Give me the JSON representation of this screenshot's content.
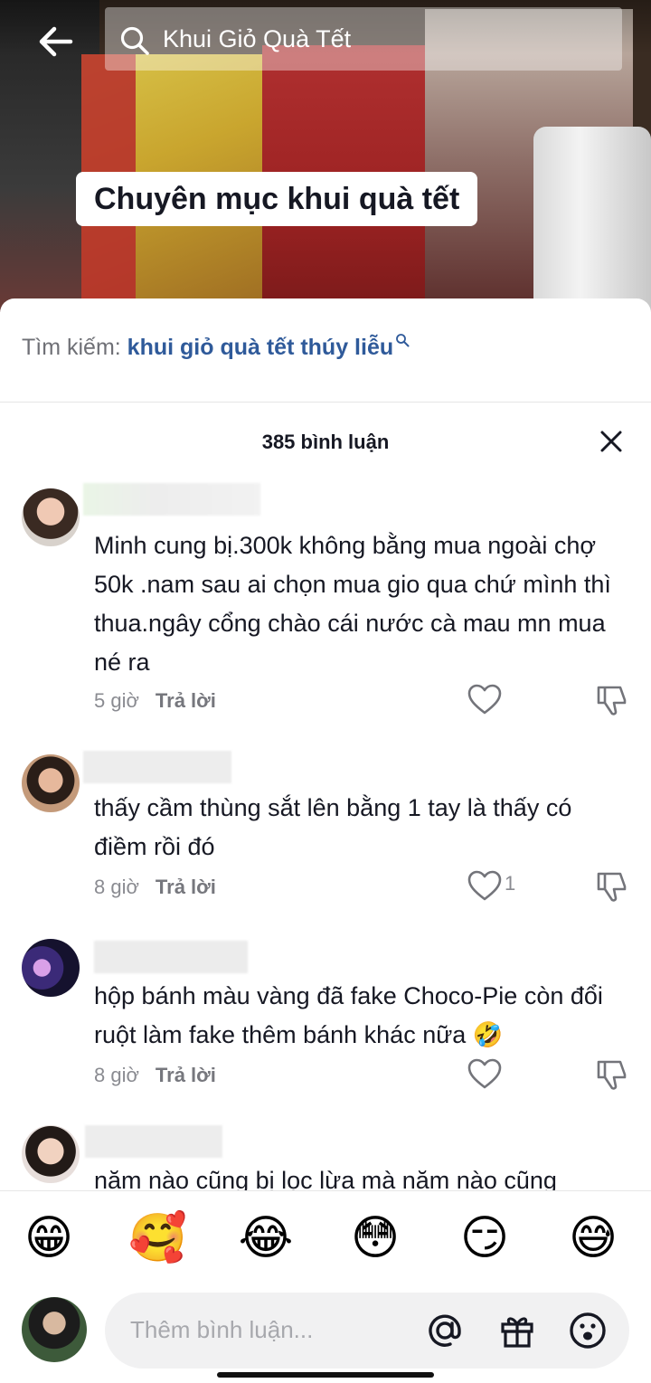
{
  "search": {
    "query": "Khui Giỏ Quà Tết"
  },
  "video": {
    "caption": "Chuyên mục khui quà tết"
  },
  "panel": {
    "suggest_label": "Tìm kiếm:",
    "suggest_term": "khui giỏ quà tết thúy liễu",
    "comment_count": "385 bình luận"
  },
  "comments": [
    {
      "text": "Minh cung bị.300k không bằng mua ngoài chợ 50k .nam sau ai chọn mua gio qua chứ mình thì thua.ngây cổng chào cái nước cà mau mn mua né ra",
      "time": "5 giờ",
      "reply": "Trả lời",
      "likes": ""
    },
    {
      "text": "thấy cầm thùng sắt lên bằng 1 tay là thấy có điềm rồi đó",
      "time": "8 giờ",
      "reply": "Trả lời",
      "likes": "1"
    },
    {
      "text": "hộp bánh màu vàng đã fake Choco-Pie còn đổi ruột làm fake thêm bánh khác nữa 🤣",
      "time": "8 giờ",
      "reply": "Trả lời",
      "likes": ""
    },
    {
      "text": "năm nào cũng bị lọc lừa mà năm nào cũng",
      "time": "",
      "reply": "",
      "likes": ""
    }
  ],
  "emojis": [
    "😁",
    "🥰",
    "😂",
    "😳",
    "😏",
    "😅"
  ],
  "input": {
    "placeholder": "Thêm bình luận..."
  },
  "icons": [
    "back-arrow-icon",
    "search-icon",
    "close-icon",
    "heart-icon",
    "dislike-icon",
    "at-mention-icon",
    "gift-icon",
    "emoji-icon"
  ]
}
